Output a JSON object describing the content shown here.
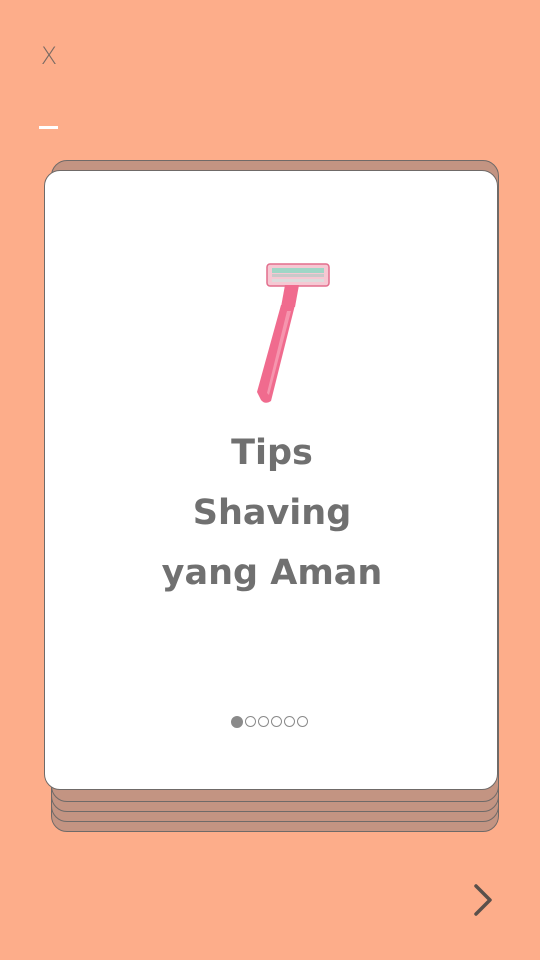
{
  "close_label": "X",
  "card": {
    "image": "razor-icon",
    "title_lines": [
      "Tips",
      "Shaving",
      "yang Aman"
    ]
  },
  "pagination": {
    "total": 6,
    "current": 1
  },
  "navigation": {
    "next_icon": "chevron-right-icon"
  },
  "colors": {
    "background": "#FDAD8A",
    "card": "#FFFFFF",
    "stack": "#C39482",
    "text": "#707070",
    "razor": "#F06B8E"
  }
}
